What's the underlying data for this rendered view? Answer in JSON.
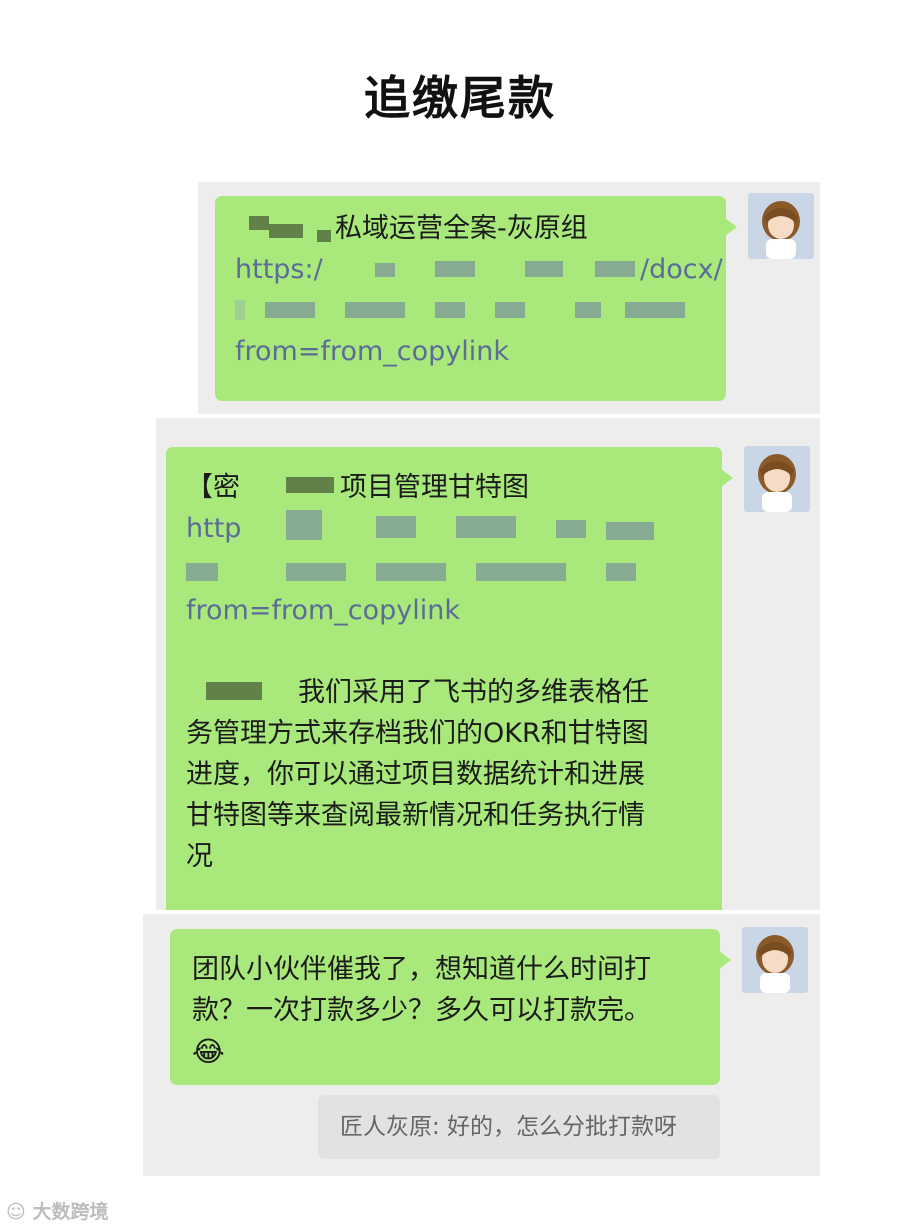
{
  "page": {
    "title": "追缴尾款"
  },
  "messages": [
    {
      "lines": [
        "私域运营全案-灰原组",
        "https:/",
        "/docx/",
        "from=from_copylink"
      ]
    },
    {
      "lines": [
        "【密",
        "项目管理甘特图",
        "http",
        "from=from_copylink",
        "我们采用了飞书的多维表格任",
        "务管理方式来存档我们的OKR和甘特图",
        "进度，你可以通过项目数据统计和进展",
        "甘特图等来查阅最新情况和任务执行情",
        "况"
      ]
    },
    {
      "lines": [
        "团队小伙伴催我了，想知道什么时间打",
        "款？一次打款多少？多久可以打款完。"
      ],
      "emoji": "😂"
    }
  ],
  "reply": {
    "text": "匠人灰原: 好的，怎么分批打款呀"
  },
  "watermark": {
    "text": "大数跨境"
  },
  "colors": {
    "bubble": "#a9e97b",
    "panel": "#ededed",
    "link": "#5b6c96"
  }
}
